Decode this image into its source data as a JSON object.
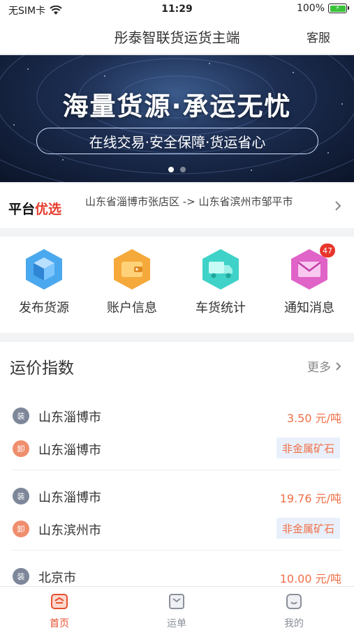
{
  "status": {
    "carrier": "无SIM卡",
    "time": "11:29",
    "battery": "100%"
  },
  "nav": {
    "title": "彤泰智联货运货主端",
    "service": "客服"
  },
  "banner": {
    "headline": "海量货源·承运无忧",
    "subline": "在线交易·安全保障·货运省心"
  },
  "platform": {
    "tag_a": "平台",
    "tag_b": "优选",
    "route": "山东省淄博市张店区 -> 山东省滨州市邹平市"
  },
  "shortcuts": [
    {
      "label": "发布货源",
      "icon": "cube-icon",
      "color": "#4aa8ef"
    },
    {
      "label": "账户信息",
      "icon": "wallet-icon",
      "color": "#f5a93a"
    },
    {
      "label": "车货统计",
      "icon": "truck-icon",
      "color": "#3fd2c8"
    },
    {
      "label": "通知消息",
      "icon": "mail-icon",
      "color": "#e063c8",
      "badge": "47"
    }
  ],
  "freight": {
    "title": "运价指数",
    "more": "更多",
    "load_tag": "装",
    "unload_tag": "卸",
    "items": [
      {
        "from": "山东淄博市",
        "to": "山东淄博市",
        "price": "3.50 元/吨",
        "cargo": "非金属矿石"
      },
      {
        "from": "山东淄博市",
        "to": "山东滨州市",
        "price": "19.76 元/吨",
        "cargo": "非金属矿石"
      },
      {
        "from": "北京市",
        "price": "10.00 元/吨"
      }
    ]
  },
  "tabs": [
    {
      "label": "首页",
      "active": true
    },
    {
      "label": "运单",
      "active": false
    },
    {
      "label": "我的",
      "active": false
    }
  ],
  "colors": {
    "accent": "#e84f2f",
    "price": "#ef6f47"
  }
}
